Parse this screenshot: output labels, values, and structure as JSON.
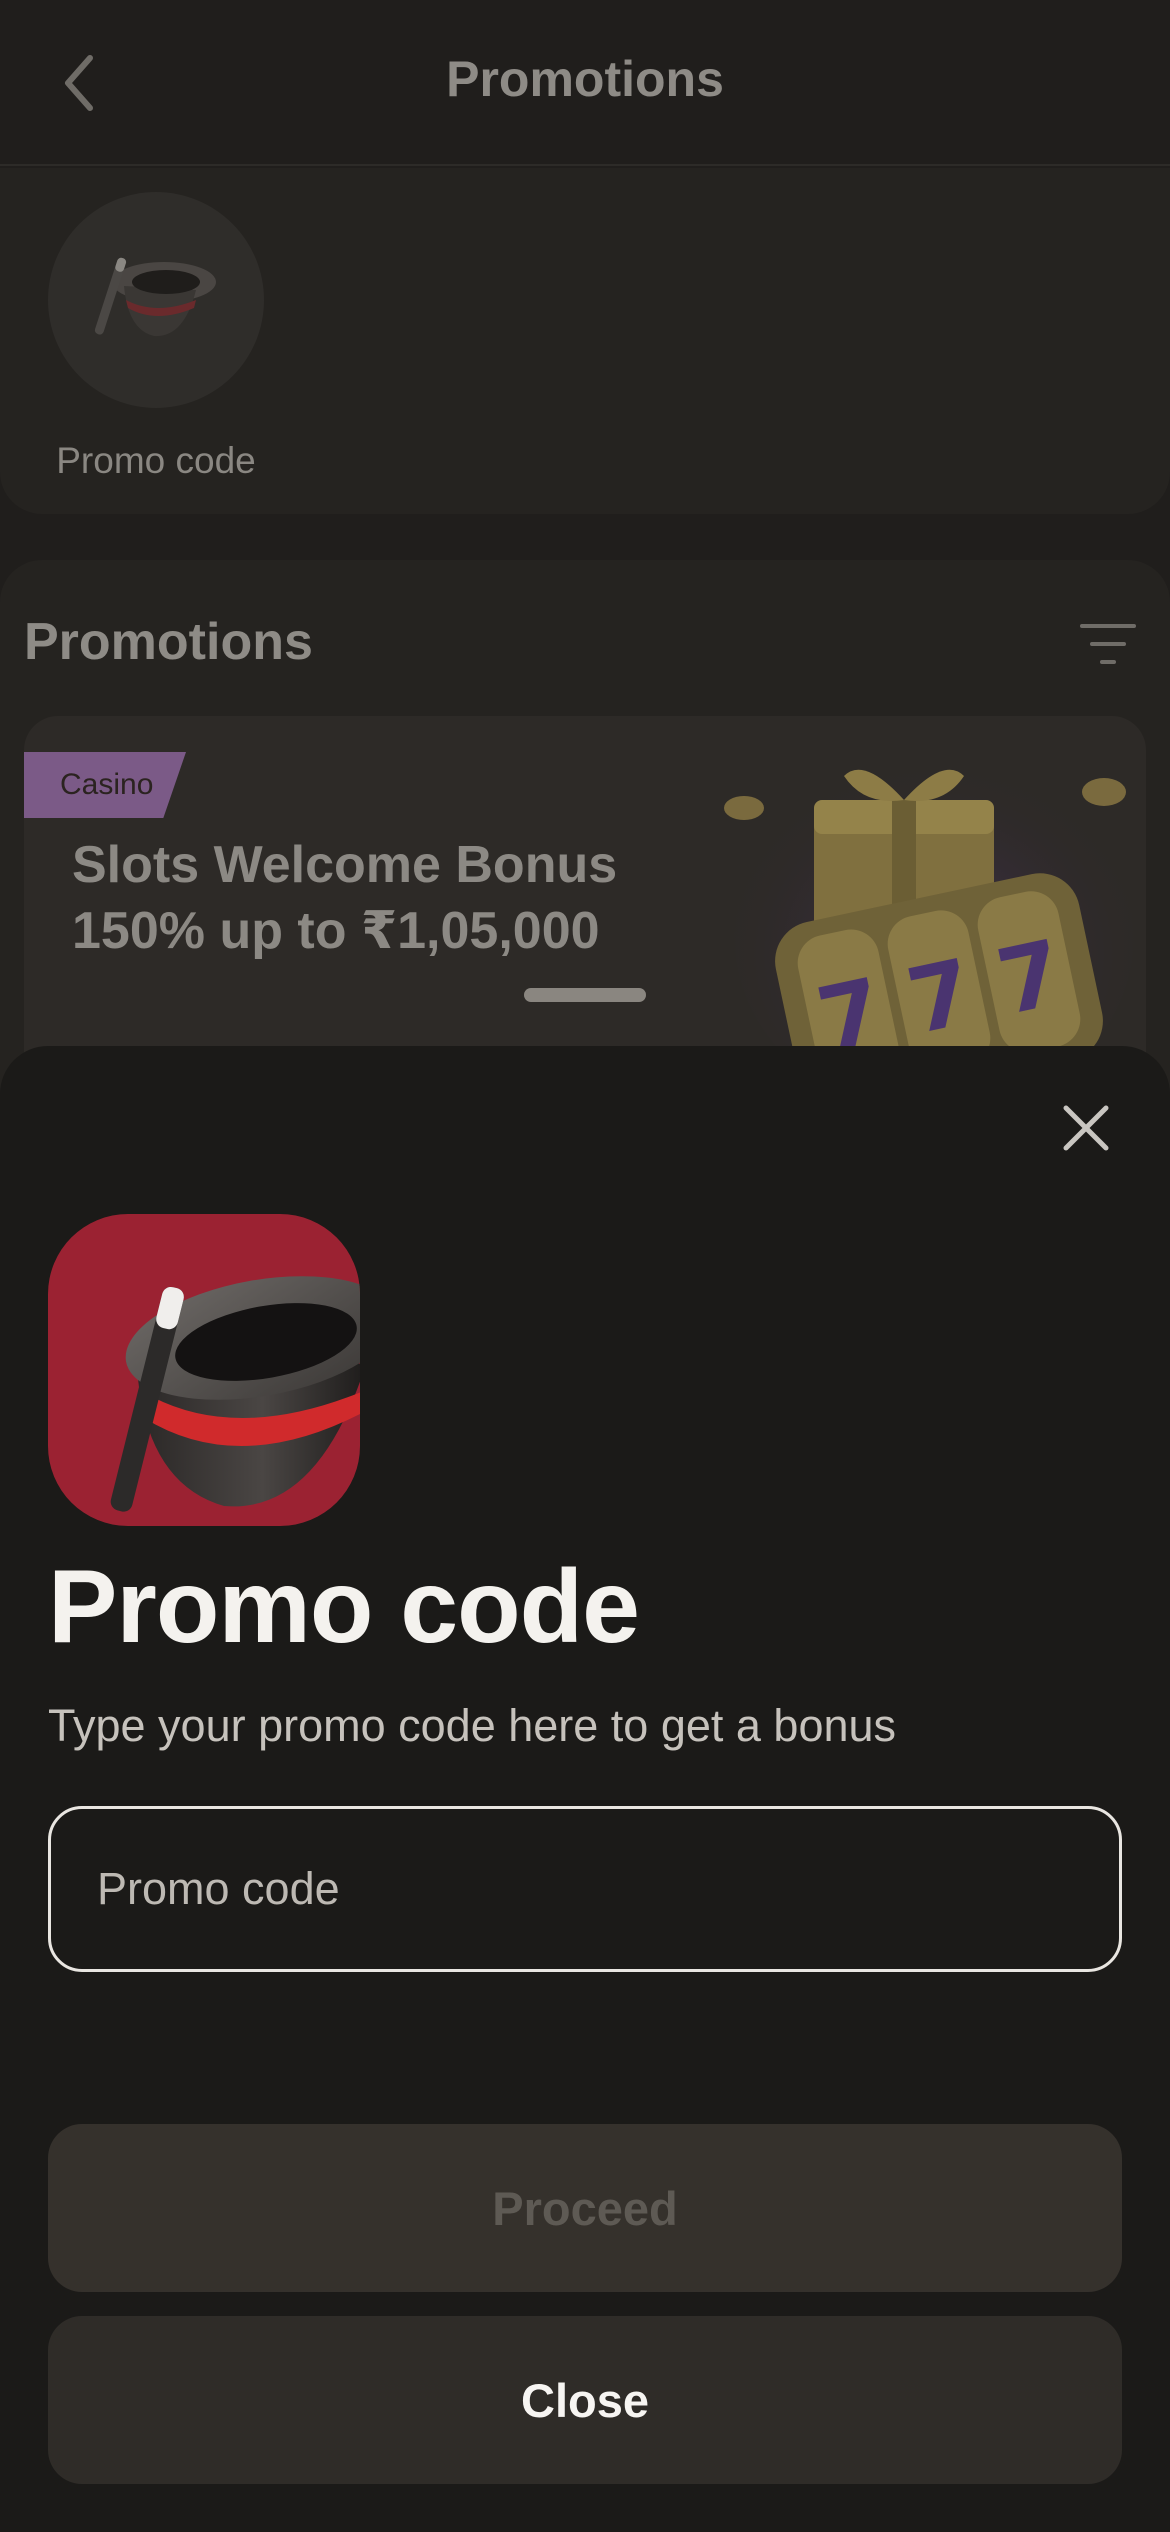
{
  "header": {
    "title": "Promotions"
  },
  "shortcut": {
    "label": "Promo code"
  },
  "section": {
    "title": "Promotions"
  },
  "banner": {
    "tag": "Casino",
    "title_line1": "Slots Welcome Bonus",
    "title_line2": "150% up to ₹1,05,000"
  },
  "sheet": {
    "title": "Promo code",
    "subtitle": "Type your promo code here to get a bonus",
    "input": {
      "placeholder": "Promo code",
      "value": ""
    },
    "proceed_label": "Proceed",
    "close_label": "Close"
  },
  "colors": {
    "sheet_bg": "#1b1a18",
    "icon_red": "#9b2232",
    "tag_purple": "#7b5a87",
    "button_bg": "#35312c"
  }
}
